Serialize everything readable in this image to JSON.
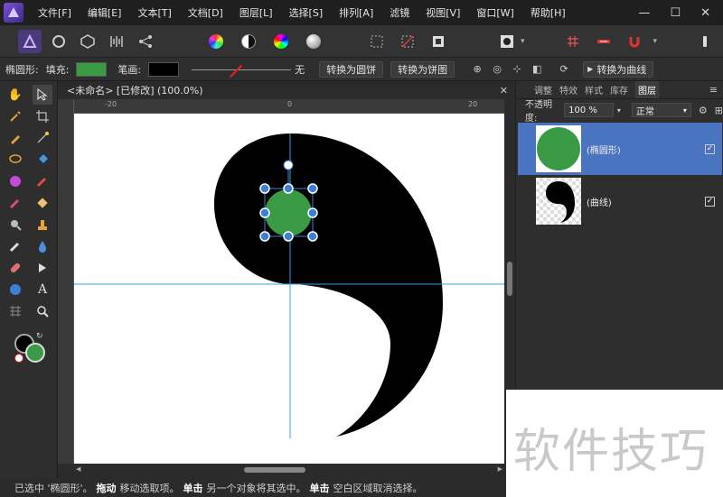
{
  "menu": [
    "文件[F]",
    "编辑[E]",
    "文本[T]",
    "文档[D]",
    "图层[L]",
    "选择[S]",
    "排列[A]",
    "滤镜",
    "视图[V]",
    "窗口[W]",
    "帮助[H]"
  ],
  "window_controls": {
    "minimize": "—",
    "maximize": "☐",
    "close": "✕"
  },
  "context": {
    "tool_name": "椭圆形:",
    "fill_label": "填充:",
    "stroke_label": "笔画:",
    "stroke_none": "无",
    "convert_ellipse": "转换为圆饼",
    "convert_pie": "转换为饼图",
    "convert_curve": "转换为曲线",
    "fill_color": "#3a9a46",
    "stroke_color": "#000000"
  },
  "document": {
    "tab_title": "<未命名> [已修改] (100.0%)",
    "close": "✕"
  },
  "ruler": {
    "unit": "mm",
    "labels": [
      "-20",
      "0",
      "20"
    ]
  },
  "panel": {
    "tabs": [
      "调整",
      "特效",
      "样式",
      "库存",
      "图层"
    ],
    "active_tab": "图层",
    "opacity_label": "不透明度:",
    "opacity_value": "100 %",
    "blend_mode": "正常",
    "layers": [
      {
        "name": "(椭圆形)",
        "selected": true,
        "visible": true
      },
      {
        "name": "(曲线)",
        "selected": false,
        "visible": true
      }
    ]
  },
  "status": {
    "selected": "已选中 '椭圆形'。",
    "drag_key": "拖动",
    "drag_text": "移动选取项。",
    "click_key": "单击",
    "click_text": "另一个对象将其选中。",
    "click2_key": "单击",
    "click2_text": "空白区域取消选择。"
  },
  "watermark": "软件技巧",
  "colors": {
    "accent_selection": "#4a73c0",
    "ellipse_fill": "#3a9a46",
    "handle": "#3b7fd6",
    "guide": "#3aa0e0"
  }
}
